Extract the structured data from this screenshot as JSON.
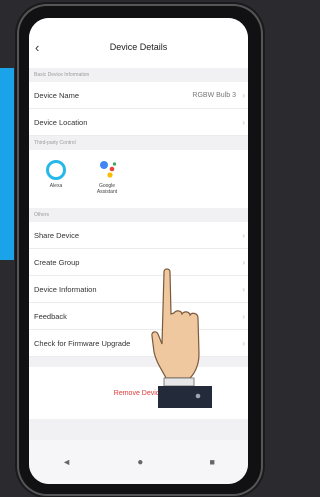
{
  "header": {
    "title": "Device Details",
    "back_icon": "chevron-left-icon"
  },
  "sections": {
    "basic": "Basic Device Information",
    "third_party": "Third-party Control",
    "others": "Others"
  },
  "basic_rows": [
    {
      "label": "Device Name",
      "value": "RGBW Bulb 3"
    },
    {
      "label": "Device Location",
      "value": ""
    }
  ],
  "third_party_items": [
    {
      "label": "Alexa",
      "icon": "alexa-icon"
    },
    {
      "label_line1": "Google",
      "label_line2": "Assistant",
      "icon": "google-assistant-icon"
    }
  ],
  "other_rows": [
    {
      "label": "Share Device"
    },
    {
      "label": "Create Group"
    },
    {
      "label": "Device Information"
    },
    {
      "label": "Feedback"
    },
    {
      "label": "Check for Firmware Upgrade"
    }
  ],
  "remove_label": "Remove Device",
  "nav": {
    "back": "◄",
    "home": "●",
    "recent": "■"
  },
  "colors": {
    "accent_blue": "#1aa3e8",
    "remove_red": "#e03a3a"
  }
}
